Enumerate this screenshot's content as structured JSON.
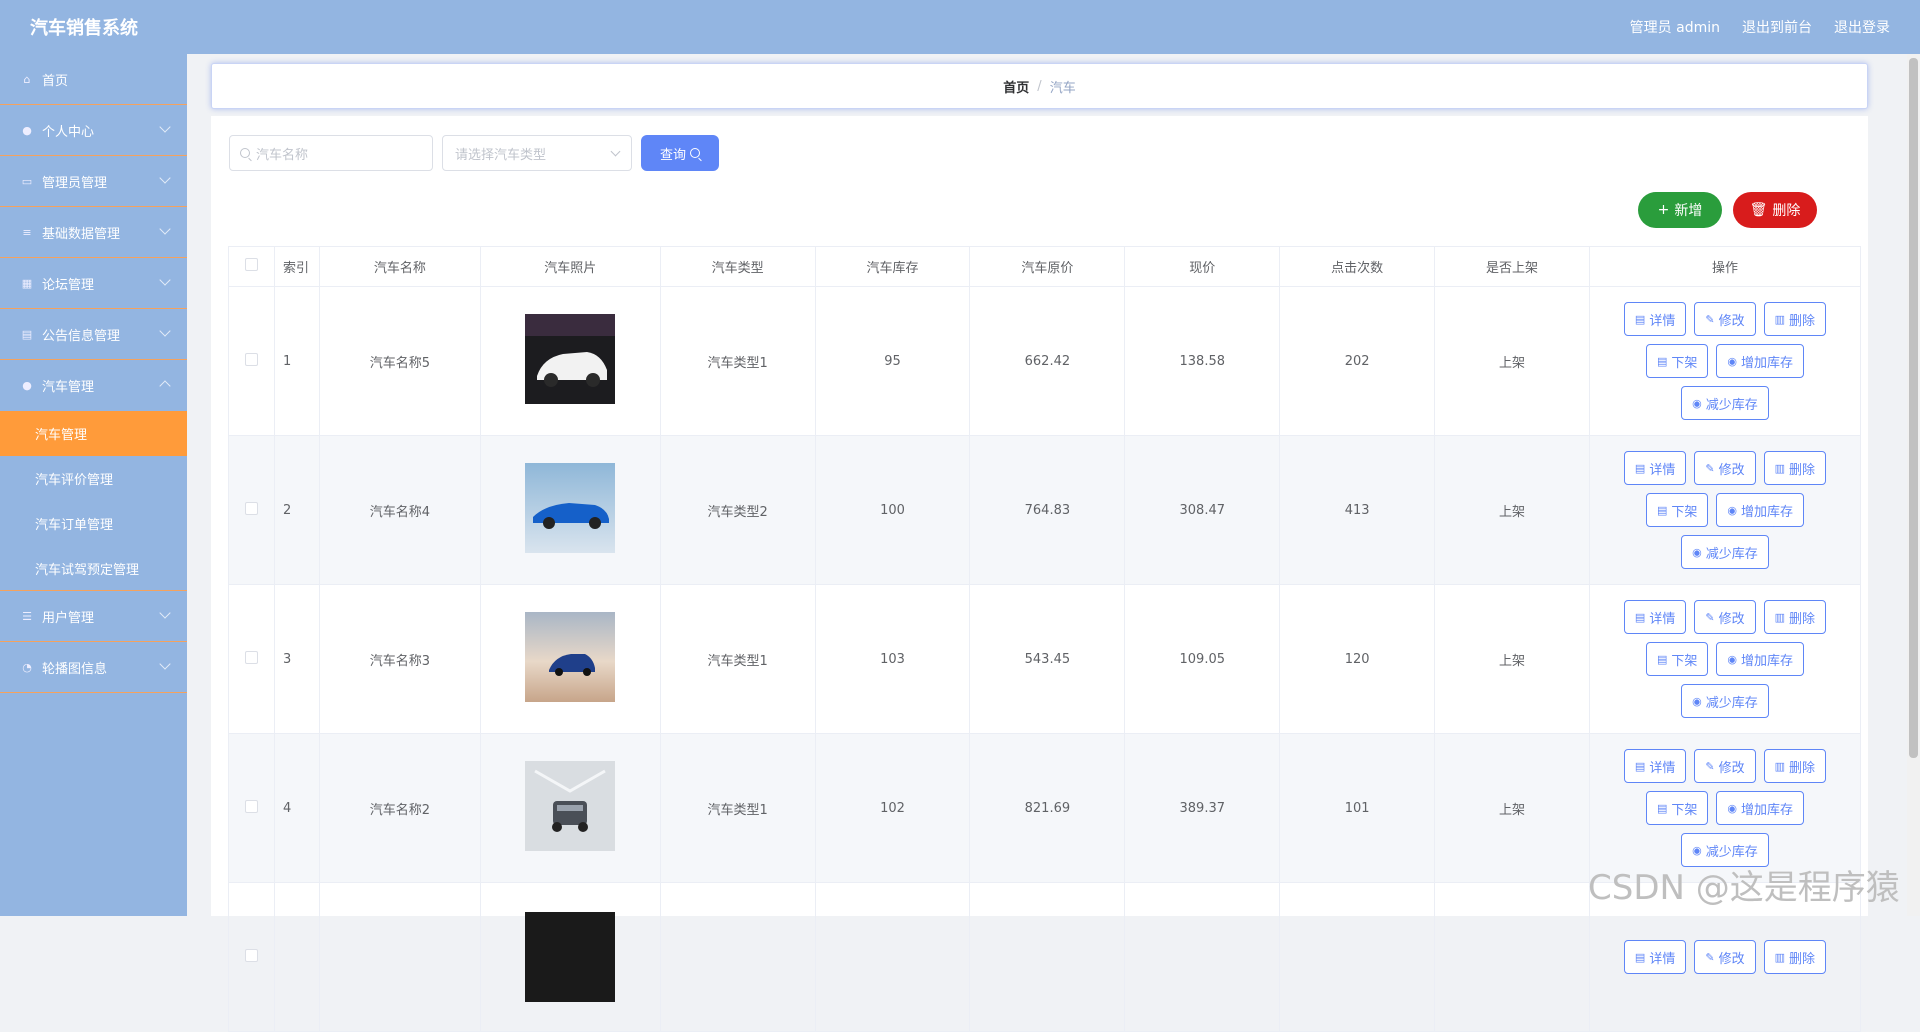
{
  "app": {
    "title": "汽车销售系统"
  },
  "topbar": {
    "admin": "管理员 admin",
    "front": "退出到前台",
    "logout": "退出登录"
  },
  "sidebar": {
    "items": [
      {
        "label": "首页"
      },
      {
        "label": "个人中心"
      },
      {
        "label": "管理员管理"
      },
      {
        "label": "基础数据管理"
      },
      {
        "label": "论坛管理"
      },
      {
        "label": "公告信息管理"
      },
      {
        "label": "汽车管理"
      },
      {
        "label": "用户管理"
      },
      {
        "label": "轮播图信息"
      }
    ],
    "subs": [
      {
        "label": "汽车管理"
      },
      {
        "label": "汽车评价管理"
      },
      {
        "label": "汽车订单管理"
      },
      {
        "label": "汽车试驾预定管理"
      }
    ]
  },
  "breadcrumb": {
    "home": "首页",
    "sep": "/",
    "current": "汽车"
  },
  "search": {
    "placeholder": "汽车名称",
    "select_placeholder": "请选择汽车类型",
    "query_label": "查询"
  },
  "actions": {
    "add_label": "新增",
    "delete_label": "删除"
  },
  "table": {
    "headers": [
      "索引",
      "汽车名称",
      "汽车照片",
      "汽车类型",
      "汽车库存",
      "汽车原价",
      "现价",
      "点击次数",
      "是否上架",
      "操作"
    ],
    "rows": [
      {
        "idx": "1",
        "name": "汽车名称5",
        "type": "汽车类型1",
        "stock": "95",
        "orig": "662.42",
        "price": "138.58",
        "clicks": "202",
        "status": "上架"
      },
      {
        "idx": "2",
        "name": "汽车名称4",
        "type": "汽车类型2",
        "stock": "100",
        "orig": "764.83",
        "price": "308.47",
        "clicks": "413",
        "status": "上架"
      },
      {
        "idx": "3",
        "name": "汽车名称3",
        "type": "汽车类型1",
        "stock": "103",
        "orig": "543.45",
        "price": "109.05",
        "clicks": "120",
        "status": "上架"
      },
      {
        "idx": "4",
        "name": "汽车名称2",
        "type": "汽车类型1",
        "stock": "102",
        "orig": "821.69",
        "price": "389.37",
        "clicks": "101",
        "status": "上架"
      }
    ],
    "ops": {
      "detail": "详情",
      "edit": "修改",
      "delete": "删除",
      "offshelf": "下架",
      "add_stock": "增加库存",
      "reduce_stock": "减少库存"
    }
  },
  "watermark": "CSDN @这是程序猿"
}
